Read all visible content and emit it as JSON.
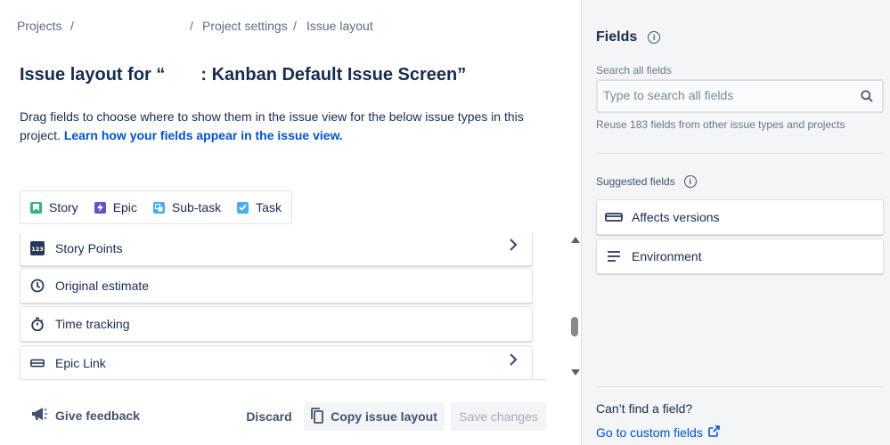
{
  "breadcrumbs": {
    "items": [
      "Projects",
      "/",
      "/",
      "Project settings",
      "/",
      "Issue layout"
    ]
  },
  "page": {
    "title_prefix": "Issue layout for “",
    "title_suffix": ": Kanban Default Issue Screen”",
    "description": "Drag fields to choose where to show them in the issue view for the below issue types in this project.",
    "learn_link": "Learn how your fields appear in the issue view."
  },
  "issue_types": [
    {
      "label": "Story",
      "icon": "story-icon",
      "color": "#36B37E"
    },
    {
      "label": "Epic",
      "icon": "epic-icon",
      "color": "#6554C0"
    },
    {
      "label": "Sub-task",
      "icon": "subtask-icon",
      "color": "#4BADE8"
    },
    {
      "label": "Task",
      "icon": "task-icon",
      "color": "#4BADE8"
    }
  ],
  "fields": [
    {
      "label": "Story Points",
      "icon": "number-icon",
      "has_chevron": true
    },
    {
      "label": "Original estimate",
      "icon": "clock-icon",
      "has_chevron": false
    },
    {
      "label": "Time tracking",
      "icon": "stopwatch-icon",
      "has_chevron": false
    },
    {
      "label": "Epic Link",
      "icon": "link-field-icon",
      "has_chevron": true
    }
  ],
  "footer": {
    "feedback": "Give feedback",
    "discard": "Discard",
    "copy": "Copy issue layout",
    "save": "Save changes"
  },
  "panel": {
    "title": "Fields",
    "search_label": "Search all fields",
    "search_placeholder": "Type to search all fields",
    "reuse_text": "Reuse 183 fields from other issue types and projects",
    "suggested_label": "Suggested fields",
    "suggested": [
      {
        "label": "Affects versions",
        "icon": "version-icon"
      },
      {
        "label": "Environment",
        "icon": "paragraph-icon"
      }
    ],
    "cant_find": "Can’t find a field?",
    "custom_link": "Go to custom fields"
  },
  "colors": {
    "link": "#0052CC",
    "text": "#172B4D",
    "panel_bg": "#F4F5F7"
  }
}
